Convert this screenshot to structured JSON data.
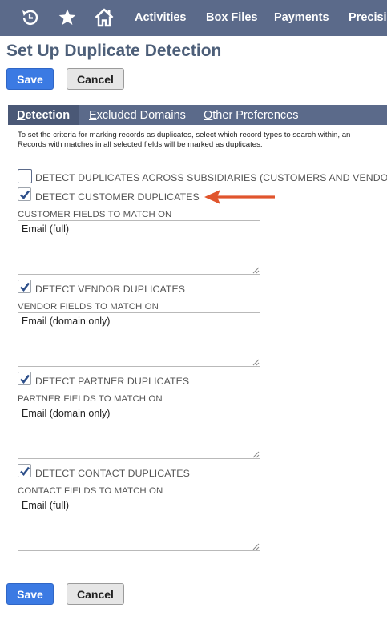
{
  "nav": {
    "icons": [
      "recent-icon",
      "star-icon",
      "home-icon"
    ],
    "links": [
      "Activities",
      "Box Files",
      "Payments",
      "Precisi"
    ]
  },
  "page": {
    "title": "Set Up Duplicate Detection"
  },
  "buttons": {
    "save": "Save",
    "cancel": "Cancel"
  },
  "tabs": [
    {
      "first": "D",
      "rest": "etection",
      "active": true
    },
    {
      "first": "E",
      "rest": "xcluded Domains",
      "active": false
    },
    {
      "first": "O",
      "rest": "ther Preferences",
      "active": false
    }
  ],
  "description": {
    "line1": "To set the criteria for marking records as duplicates, select which record types to search within, an",
    "line2": "Records with matches in all selected fields will be marked as duplicates."
  },
  "subsidiaries": {
    "label": "DETECT DUPLICATES ACROSS SUBSIDIARIES (CUSTOMERS AND VENDORS",
    "checked": false
  },
  "sections": [
    {
      "check_label": "DETECT CUSTOMER DUPLICATES",
      "checked": true,
      "field_label": "CUSTOMER FIELDS TO MATCH ON",
      "value": "Email (full)"
    },
    {
      "check_label": "DETECT VENDOR DUPLICATES",
      "checked": true,
      "field_label": "VENDOR FIELDS TO MATCH ON",
      "value": "Email (domain only)"
    },
    {
      "check_label": "DETECT PARTNER DUPLICATES",
      "checked": true,
      "field_label": "PARTNER FIELDS TO MATCH ON",
      "value": "Email (domain only)"
    },
    {
      "check_label": "DETECT CONTACT DUPLICATES",
      "checked": true,
      "field_label": "CONTACT FIELDS TO MATCH ON",
      "value": "Email (full)"
    }
  ],
  "colors": {
    "nav": "#5b6a8a",
    "primary": "#3b7ae3",
    "title": "#4d5f79",
    "arrow": "#e0552d",
    "check": "#2d4f8a"
  }
}
